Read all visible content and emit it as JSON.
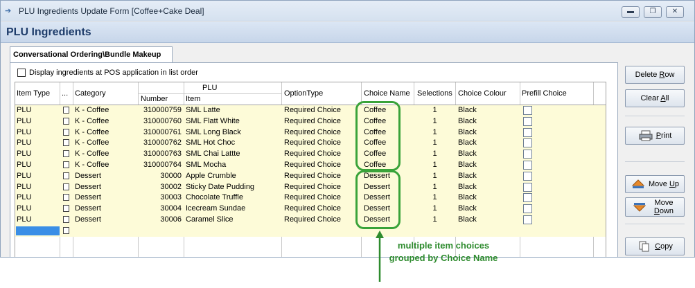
{
  "window": {
    "title": "PLU Ingredients Update Form [Coffee+Cake Deal]",
    "header": "PLU Ingredients",
    "controls": [
      "minimize",
      "restore",
      "close"
    ]
  },
  "tab": {
    "label": "Conversational Ordering\\Bundle Makeup"
  },
  "display_option": {
    "label": "Display ingredients at POS application in list order",
    "checked": false
  },
  "grid": {
    "columns": {
      "item_type": "Item Type",
      "dots": "...",
      "category": "Category",
      "plu_group": "PLU",
      "number": "Number",
      "item": "Item",
      "option_type": "OptionType",
      "choice_name": "Choice Name",
      "selections": "Selections",
      "choice_colour": "Choice Colour",
      "prefill_choice": "Prefill Choice"
    },
    "rows": [
      {
        "item_type": "PLU",
        "category": "K - Coffee",
        "number": "310000759",
        "item": "SML Latte",
        "option_type": "Required Choice",
        "choice_name": "Coffee",
        "selections": "1",
        "choice_colour": "Black",
        "prefill": false
      },
      {
        "item_type": "PLU",
        "category": "K - Coffee",
        "number": "310000760",
        "item": "SML Flatt White",
        "option_type": "Required Choice",
        "choice_name": "Coffee",
        "selections": "1",
        "choice_colour": "Black",
        "prefill": false
      },
      {
        "item_type": "PLU",
        "category": "K - Coffee",
        "number": "310000761",
        "item": "SML Long Black",
        "option_type": "Required Choice",
        "choice_name": "Coffee",
        "selections": "1",
        "choice_colour": "Black",
        "prefill": false
      },
      {
        "item_type": "PLU",
        "category": "K - Coffee",
        "number": "310000762",
        "item": "SML Hot Choc",
        "option_type": "Required Choice",
        "choice_name": "Coffee",
        "selections": "1",
        "choice_colour": "Black",
        "prefill": false
      },
      {
        "item_type": "PLU",
        "category": "K - Coffee",
        "number": "310000763",
        "item": "SML Chai Lattte",
        "option_type": "Required Choice",
        "choice_name": "Coffee",
        "selections": "1",
        "choice_colour": "Black",
        "prefill": false
      },
      {
        "item_type": "PLU",
        "category": "K - Coffee",
        "number": "310000764",
        "item": "SML Mocha",
        "option_type": "Required Choice",
        "choice_name": "Coffee",
        "selections": "1",
        "choice_colour": "Black",
        "prefill": false
      },
      {
        "item_type": "PLU",
        "category": "Dessert",
        "number": "30000",
        "item": "Apple Crumble",
        "option_type": "Required Choice",
        "choice_name": "Dessert",
        "selections": "1",
        "choice_colour": "Black",
        "prefill": false
      },
      {
        "item_type": "PLU",
        "category": "Dessert",
        "number": "30002",
        "item": "Sticky Date Pudding",
        "option_type": "Required Choice",
        "choice_name": "Dessert",
        "selections": "1",
        "choice_colour": "Black",
        "prefill": false
      },
      {
        "item_type": "PLU",
        "category": "Dessert",
        "number": "30003",
        "item": "Chocolate Truffle",
        "option_type": "Required Choice",
        "choice_name": "Dessert",
        "selections": "1",
        "choice_colour": "Black",
        "prefill": false
      },
      {
        "item_type": "PLU",
        "category": "Dessert",
        "number": "30004",
        "item": "Icecream Sundae",
        "option_type": "Required Choice",
        "choice_name": "Dessert",
        "selections": "1",
        "choice_colour": "Black",
        "prefill": false
      },
      {
        "item_type": "PLU",
        "category": "Dessert",
        "number": "30006",
        "item": "Caramel Slice",
        "option_type": "Required Choice",
        "choice_name": "Dessert",
        "selections": "1",
        "choice_colour": "Black",
        "prefill": false
      }
    ]
  },
  "buttons": {
    "delete_row": "Delete Row",
    "clear_all": "Clear All",
    "print": "Print",
    "move_up": "Move Up",
    "move_down": "Move Down",
    "copy": "Copy"
  },
  "annotation": {
    "text": "multiple item choices grouped by Choice Name",
    "color": "#2e8b2e"
  },
  "colors": {
    "row_highlight": "#fdfbd8",
    "selection": "#3a8ee6",
    "header_text": "#1e3c6a"
  }
}
